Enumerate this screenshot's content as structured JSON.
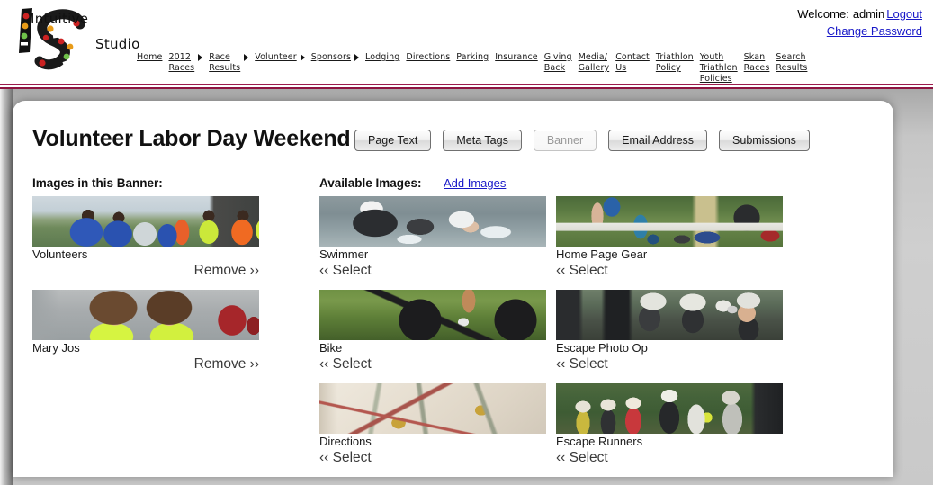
{
  "header": {
    "logo": {
      "brand_line1": "Intuitive",
      "brand_line2": "Studio",
      "dot_colors": [
        "#cc2222",
        "#e89b18",
        "#6fc24a",
        "#ffffff"
      ]
    },
    "welcome": {
      "label": "Welcome:",
      "user": "admin",
      "logout_label": "Logout",
      "change_password_label": "Change Password",
      "link_color": "#1818c8"
    },
    "nav": [
      {
        "label": "Home",
        "has_arrow": false
      },
      {
        "label": "2012\nRaces",
        "has_arrow": true
      },
      {
        "label": "Race\nResults",
        "has_arrow": true
      },
      {
        "label": "Volunteer",
        "has_arrow": true
      },
      {
        "label": "Sponsors",
        "has_arrow": true
      },
      {
        "label": "Lodging",
        "has_arrow": false
      },
      {
        "label": "Directions",
        "has_arrow": false
      },
      {
        "label": "Parking",
        "has_arrow": false
      },
      {
        "label": "Insurance",
        "has_arrow": false
      },
      {
        "label": "Giving\nBack",
        "has_arrow": false
      },
      {
        "label": "Media/\nGallery",
        "has_arrow": false
      },
      {
        "label": "Contact\nUs",
        "has_arrow": false
      },
      {
        "label": "Triathlon\nPolicy",
        "has_arrow": false
      },
      {
        "label": "Youth\nTriathlon\nPolicies",
        "has_arrow": false
      },
      {
        "label": "Skan\nRaces",
        "has_arrow": false
      },
      {
        "label": "Search\nResults",
        "has_arrow": false
      }
    ],
    "rule_color": "#8e1541"
  },
  "main": {
    "page_title": "Volunteer Labor Day Weekend",
    "toolbar": [
      {
        "label": "Page Text",
        "disabled": false
      },
      {
        "label": "Meta Tags",
        "disabled": false
      },
      {
        "label": "Banner",
        "disabled": true
      },
      {
        "label": "Email Address",
        "disabled": false
      },
      {
        "label": "Submissions",
        "disabled": false
      }
    ],
    "selected_heading": "Images in this Banner:",
    "available_heading": "Available Images:",
    "add_images_label": "Add Images",
    "remove_label": "Remove ››",
    "select_label": "‹‹  Select",
    "selected_images": [
      {
        "name": "Volunteers",
        "action": "Remove ››"
      },
      {
        "name": "Mary Jos",
        "action": "Remove ››"
      }
    ],
    "available_images": [
      {
        "name": "Swimmer",
        "action": "‹‹  Select"
      },
      {
        "name": "Home Page Gear",
        "action": "‹‹  Select"
      },
      {
        "name": "Bike",
        "action": "‹‹  Select"
      },
      {
        "name": "Escape Photo Op",
        "action": "‹‹  Select"
      },
      {
        "name": "Directions",
        "action": "‹‹  Select"
      },
      {
        "name": "Escape Runners",
        "action": "‹‹  Select"
      }
    ]
  }
}
